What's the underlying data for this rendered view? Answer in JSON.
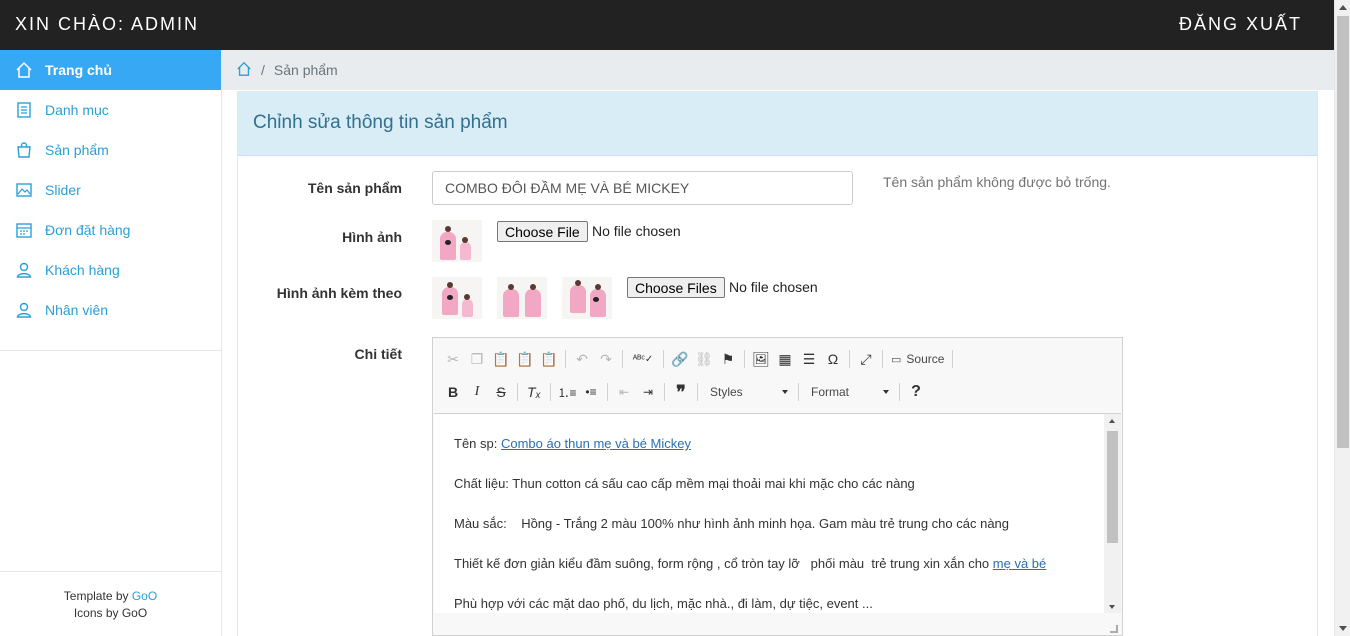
{
  "header": {
    "greeting": "XIN CHÀO: ADMIN",
    "logout": "ĐĂNG XUẤT"
  },
  "sidebar": {
    "items": [
      {
        "label": "Trang chủ",
        "icon": "home-icon",
        "active": true
      },
      {
        "label": "Danh mục",
        "icon": "list-icon"
      },
      {
        "label": "Sản phẩm",
        "icon": "bag-icon"
      },
      {
        "label": "Slider",
        "icon": "image-icon"
      },
      {
        "label": "Đơn đặt hàng",
        "icon": "calendar-icon"
      },
      {
        "label": "Khách hàng",
        "icon": "user-icon"
      },
      {
        "label": "Nhân viên",
        "icon": "user-icon"
      }
    ],
    "footer": {
      "template_prefix": "Template by",
      "template_link": "GoO",
      "icons_text": "Icons by GoO"
    }
  },
  "breadcrumb": {
    "current": "Sản phẩm",
    "separator": "/"
  },
  "panel": {
    "title": "Chỉnh sửa thông tin sản phẩm"
  },
  "form": {
    "name_label": "Tên sản phẩm",
    "name_value": "COMBO ĐÔI ĐẦM MẸ VÀ BÉ MICKEY",
    "name_help": "Tên sản phẩm không được bỏ trống.",
    "image_label": "Hình ảnh",
    "image_button": "Choose File",
    "image_status": "No file chosen",
    "extra_images_label": "Hình ảnh kèm theo",
    "extra_images_button": "Choose Files",
    "extra_images_status": "No file chosen",
    "detail_label": "Chi tiết"
  },
  "editor": {
    "source_label": "Source",
    "styles_label": "Styles",
    "format_label": "Format",
    "help_label": "?",
    "lines": [
      {
        "prefix": "Tên sp: ",
        "link": "Combo áo thun mẹ và bé Mickey",
        "suffix": ""
      },
      {
        "prefix": "Chất liệu: Thun cotton cá sấu cao cấp mềm mại thoải mai khi mặc cho các nàng",
        "link": "",
        "suffix": ""
      },
      {
        "prefix": "Màu sắc:    Hồng - Trắng 2 màu 100% như hình ảnh minh họa. Gam màu trẻ trung cho các nàng",
        "link": "",
        "suffix": ""
      },
      {
        "prefix": "Thiết kế đơn giản kiểu đầm suông, form rộng , cổ tròn tay lỡ   phối màu  trẻ trung xin xắn cho ",
        "link": "mẹ và bé",
        "suffix": ""
      },
      {
        "prefix": "Phù hợp với các mặt dao phố, du lịch, mặc nhà., đi làm, dự tiệc, event ...",
        "link": "",
        "suffix": ""
      }
    ]
  },
  "colors": {
    "topbar": "#222222",
    "active": "#37a9f4",
    "link": "#2a9fd6",
    "panel_head": "#d9edf7"
  }
}
